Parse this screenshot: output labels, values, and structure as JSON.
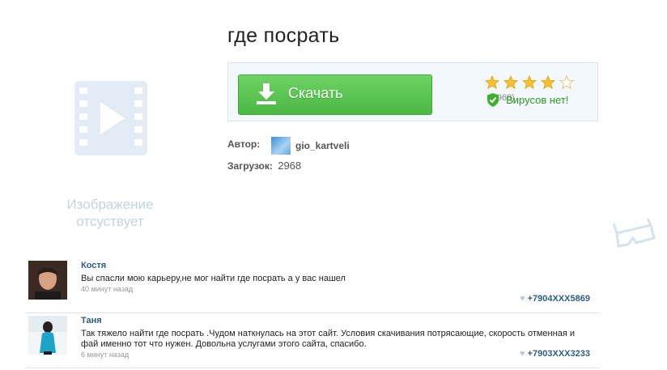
{
  "page": {
    "title": "где посрать"
  },
  "placeholder": {
    "icon": "film-play-icon",
    "text_line1": "Изображение",
    "text_line2": "отсуствует"
  },
  "download": {
    "button_label": "Скачать",
    "button_icon": "download-arrow-icon",
    "rating": {
      "stars_filled": 4,
      "stars_total": 5,
      "count": "(2968)"
    },
    "virus_label": "Вирусов нет!",
    "colors": {
      "button": "#5cc653",
      "virus_text": "#2a9b1e",
      "panel_bg": "#f2f8fd"
    }
  },
  "meta": {
    "author_label": "Автор:",
    "author_name": "gio_kartveli",
    "downloads_label": "Загрузок:",
    "downloads_value": "2968"
  },
  "comments": [
    {
      "name": "Костя",
      "text": "Вы спасли мою карьеру,не мог найти где посрать а у вас нашел",
      "time": "40 минут назад",
      "phone": "+7904XXX5869"
    },
    {
      "name": "Таня",
      "text": "Так тяжело найти где посрать .Чудом наткнулась на этот сайт. Условия скачивания потрясающие, скорость отменная и фай именно тот что нужен. Довольна услугами этого сайта, спасибо.",
      "time": "6 минут назад",
      "phone": "+7903XXX3233"
    }
  ]
}
